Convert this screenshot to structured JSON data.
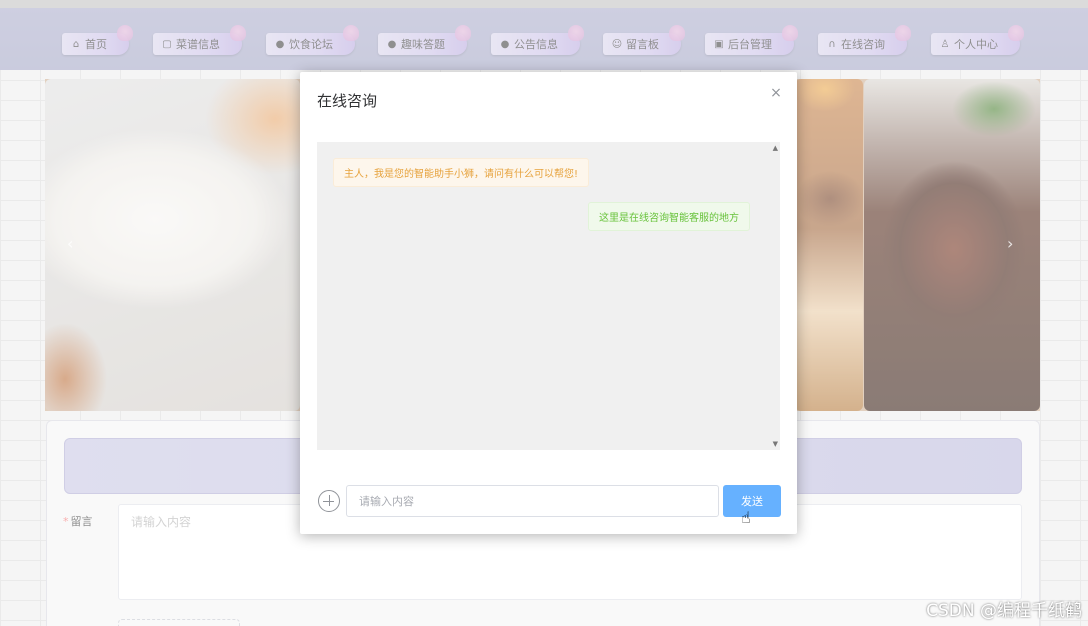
{
  "nav": {
    "items": [
      {
        "label": "首页",
        "icon": "home-icon",
        "glyph": "⌂"
      },
      {
        "label": "菜谱信息",
        "icon": "bag-icon",
        "glyph": "▢"
      },
      {
        "label": "饮食论坛",
        "icon": "info-icon",
        "glyph": "●"
      },
      {
        "label": "趣味答题",
        "icon": "question-icon",
        "glyph": "●"
      },
      {
        "label": "公告信息",
        "icon": "info-icon",
        "glyph": "●"
      },
      {
        "label": "留言板",
        "icon": "smile-icon",
        "glyph": "☺"
      },
      {
        "label": "后台管理",
        "icon": "clipboard-icon",
        "glyph": "▣"
      },
      {
        "label": "在线咨询",
        "icon": "headset-icon",
        "glyph": "∩"
      },
      {
        "label": "个人中心",
        "icon": "user-icon",
        "glyph": "♙"
      }
    ]
  },
  "carousel": {
    "prev": "‹",
    "next": "›"
  },
  "form": {
    "required_mark": "*",
    "message_label": "留言",
    "message_placeholder": "请输入内容"
  },
  "dialog": {
    "title": "在线咨询",
    "close_glyph": "×",
    "messages": {
      "bot": "主人，我是您的智能助手小狮，请问有什么可以帮您!",
      "user": "这里是在线咨询智能客服的地方"
    },
    "input_placeholder": "请输入内容",
    "send_label": "发送"
  },
  "watermark": "CSDN @编程千纸鹤",
  "colors": {
    "accent": "#66b1ff",
    "bot_text": "#e6a23c",
    "user_text": "#67c23a",
    "required": "#f56c6c"
  }
}
